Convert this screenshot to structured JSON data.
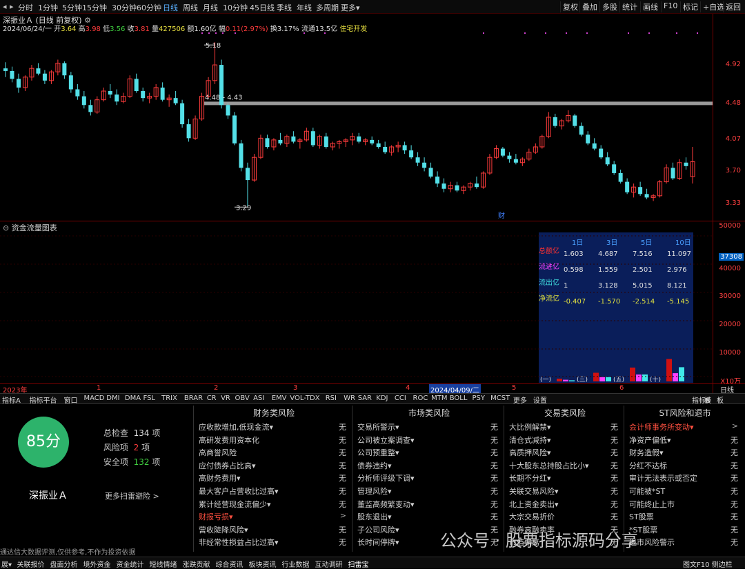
{
  "toolbar": {
    "periods": [
      "分时",
      "1分钟",
      "5分钟",
      "15分钟",
      "30分钟",
      "60分钟",
      "日线",
      "周线",
      "月线",
      "10分钟",
      "45日线",
      "季线",
      "年线",
      "多周期",
      "更多▾"
    ],
    "active": "日线",
    "right": [
      "复权",
      "叠加",
      "多股",
      "统计",
      "画线",
      "F10",
      "标记",
      "+自选",
      "返回"
    ]
  },
  "stock": {
    "name": "深振业Ａ",
    "mode": "(日线 前复权)"
  },
  "quote": {
    "date": "2024/06/24/一",
    "open_l": "开",
    "open": "3.64",
    "high_l": "高",
    "high": "3.98",
    "low_l": "低",
    "low": "3.56",
    "close_l": "收",
    "close": "3.81",
    "vol_l": "量",
    "vol": "427506",
    "amt_l": "额",
    "amt": "1.60亿",
    "chg_l": "幅",
    "chg": "0.11(2.97%)",
    "turn_l": "换",
    "turn": "3.17%",
    "float_l": "流通",
    "float": "13.5亿",
    "industry": "住宅开发"
  },
  "price_axis": [
    "4.92",
    "4.48",
    "4.07",
    "3.70",
    "3.33"
  ],
  "annotations": {
    "high": "5.18",
    "range": "4.48 - 4.43",
    "low": "3.29",
    "cai": "财"
  },
  "flow": {
    "title": "资金流量图表",
    "axis": [
      "50000",
      "40000",
      "37308",
      "30000",
      "20000",
      "10000",
      "X10万"
    ],
    "headers": [
      "1日",
      "3日",
      "5日",
      "10日"
    ],
    "rows": [
      {
        "label": "总额亿",
        "vals": [
          "1.603",
          "4.687",
          "7.516",
          "11.097"
        ]
      },
      {
        "label": "流进亿",
        "vals": [
          "0.598",
          "1.559",
          "2.501",
          "2.976"
        ]
      },
      {
        "label": "流出亿",
        "vals": [
          "1",
          "3.128",
          "5.015",
          "8.121"
        ]
      },
      {
        "label": "净流亿",
        "vals": [
          "-0.407",
          "-1.570",
          "-2.514",
          "-5.145"
        ]
      }
    ],
    "groups": [
      "(一)",
      "(三)",
      "(五)",
      "(十)"
    ],
    "bars": [
      {
        "in": 0.598,
        "out": 1
      },
      {
        "in": 1.559,
        "out": 3.128
      },
      {
        "in": 2.501,
        "out": 5.015
      },
      {
        "in": 2.976,
        "out": 8.121
      }
    ]
  },
  "timeline": [
    "2023年",
    "1",
    "2",
    "3",
    "4",
    "2024/04/09/二",
    "5",
    "6",
    "日线"
  ],
  "indicators": [
    "指标A",
    "指标平台",
    "窗口",
    "MACD",
    "DMI",
    "DMA",
    "FSL",
    "TRIX",
    "BRAR",
    "CR",
    "VR",
    "OBV",
    "ASI",
    "EMV",
    "VOL-TDX",
    "RSI",
    "WR",
    "SAR",
    "KDJ",
    "CCI",
    "ROC",
    "MTM",
    "BOLL",
    "PSY",
    "MCST",
    "更多",
    "设置"
  ],
  "ind_right": [
    "指标B",
    "模",
    "板"
  ],
  "scan": {
    "score": "85分",
    "stock": "深振业Ａ",
    "total_l": "总检查",
    "total": "134",
    "total_u": "项",
    "risk_l": "风险项",
    "risk": "2",
    "risk_u": "项",
    "safe_l": "安全项",
    "safe": "132",
    "safe_u": "项",
    "more": "更多扫雷避险 >"
  },
  "columns": [
    {
      "title": "财务类风险",
      "items": [
        [
          "应收款增加,低现金流▾",
          "无"
        ],
        [
          "高研发费用资本化",
          "无"
        ],
        [
          "高商誉风险",
          "无"
        ],
        [
          "应付债券占比高▾",
          "无"
        ],
        [
          "高财务费用▾",
          "无"
        ],
        [
          "最大客户占营收比过高▾",
          "无"
        ],
        [
          "累计经营现金流偏少▾",
          "无"
        ],
        [
          "财报亏损▾",
          ">"
        ],
        [
          "营收陡降风险▾",
          "无"
        ],
        [
          "非经常性损益占比过高▾",
          "无"
        ]
      ]
    },
    {
      "title": "市场类风险",
      "items": [
        [
          "交易所警示▾",
          "无"
        ],
        [
          "公司被立案调查▾",
          "无"
        ],
        [
          "公司预重整▾",
          "无"
        ],
        [
          "债券违约▾",
          "无"
        ],
        [
          "分析师评级下调▾",
          "无"
        ],
        [
          "管理风险▾",
          "无"
        ],
        [
          "董监高频繁变动▾",
          "无"
        ],
        [
          "股东退出▾",
          "无"
        ],
        [
          "子公司风险▾",
          "无"
        ],
        [
          "长时间停牌▾",
          "无"
        ]
      ]
    },
    {
      "title": "交易类风险",
      "items": [
        [
          "大比例解禁▾",
          "无"
        ],
        [
          "清仓式减持▾",
          "无"
        ],
        [
          "高质押风险▾",
          "无"
        ],
        [
          "十大股东总持股占比小▾",
          "无"
        ],
        [
          "长期不分红▾",
          "无"
        ],
        [
          "关联交易风险▾",
          "无"
        ],
        [
          "北上资金卖出▾",
          "无"
        ],
        [
          "大宗交易折价",
          "无"
        ],
        [
          "融券高融卖率",
          "无"
        ],
        [
          "市值偏离",
          "无"
        ]
      ]
    },
    {
      "title": "ST风险和退市",
      "items": [
        [
          "会计师事务所变动▾",
          ">"
        ],
        [
          "净资产偏低▾",
          "无"
        ],
        [
          "财务造假▾",
          "无"
        ],
        [
          "分红不达标",
          "无"
        ],
        [
          "审计无法表示或否定",
          "无"
        ],
        [
          "可能被*ST",
          "无"
        ],
        [
          "可能终止上市",
          "无"
        ],
        [
          "ST股票",
          "无"
        ],
        [
          "*ST股票",
          "无"
        ],
        [
          "退市风险警示",
          "无"
        ]
      ]
    }
  ],
  "disclaimer": "通达信大数据评测,仅供参考,不作为投资依据",
  "status": [
    "展▾",
    "关联报价",
    "盘面分析",
    "境外资金",
    "资金统计",
    "短线情绪",
    "涨跌贡献",
    "综合资讯",
    "板块资讯",
    "行业数据",
    "互动调研",
    "扫雷宝"
  ],
  "status_right": "图文F10 侧边栏",
  "watermark": "公众号 · 股票指标源码分享",
  "chart_data": {
    "type": "candlestick",
    "ylim": [
      3.15,
      5.3
    ],
    "ohlc": [
      [
        4.88,
        4.95,
        4.78,
        4.85
      ],
      [
        4.85,
        4.9,
        4.72,
        4.76
      ],
      [
        4.76,
        4.82,
        4.6,
        4.66
      ],
      [
        4.66,
        4.8,
        4.62,
        4.78
      ],
      [
        4.78,
        4.92,
        4.74,
        4.88
      ],
      [
        4.88,
        4.94,
        4.8,
        4.82
      ],
      [
        4.82,
        4.86,
        4.7,
        4.74
      ],
      [
        4.74,
        4.86,
        4.7,
        4.84
      ],
      [
        4.84,
        4.98,
        4.8,
        4.94
      ],
      [
        4.94,
        4.96,
        4.76,
        4.8
      ],
      [
        4.8,
        4.84,
        4.6,
        4.64
      ],
      [
        4.64,
        4.7,
        4.52,
        4.56
      ],
      [
        4.56,
        4.62,
        4.42,
        4.46
      ],
      [
        4.46,
        4.52,
        4.34,
        4.38
      ],
      [
        4.38,
        4.56,
        4.36,
        4.52
      ],
      [
        4.52,
        4.66,
        4.5,
        4.62
      ],
      [
        4.62,
        4.7,
        4.54,
        4.58
      ],
      [
        4.58,
        4.64,
        4.46,
        4.5
      ],
      [
        4.5,
        4.6,
        4.48,
        4.56
      ],
      [
        4.56,
        4.8,
        4.54,
        4.76
      ],
      [
        4.76,
        4.82,
        4.6,
        4.62
      ],
      [
        4.62,
        4.66,
        4.5,
        4.54
      ],
      [
        4.54,
        4.6,
        4.48,
        4.56
      ],
      [
        4.56,
        4.7,
        4.52,
        4.66
      ],
      [
        4.66,
        4.72,
        4.5,
        4.52
      ],
      [
        4.52,
        4.58,
        4.44,
        4.54
      ],
      [
        4.54,
        4.62,
        4.46,
        4.48
      ],
      [
        4.48,
        4.52,
        4.2,
        4.24
      ],
      [
        4.24,
        4.3,
        4.04,
        4.08
      ],
      [
        4.08,
        4.34,
        4.06,
        4.3
      ],
      [
        4.3,
        4.6,
        4.28,
        4.56
      ],
      [
        4.56,
        4.78,
        4.54,
        4.74
      ],
      [
        4.74,
        5.18,
        4.7,
        4.92
      ],
      [
        4.92,
        4.98,
        4.42,
        4.46
      ],
      [
        4.46,
        4.48,
        4.3,
        4.34
      ],
      [
        4.34,
        4.38,
        4.0,
        4.02
      ],
      [
        4.02,
        4.06,
        3.7,
        3.74
      ],
      [
        3.74,
        3.8,
        3.29,
        3.6
      ],
      [
        3.6,
        3.9,
        3.58,
        3.86
      ],
      [
        3.86,
        4.12,
        3.84,
        4.08
      ],
      [
        4.08,
        4.12,
        3.96,
        3.98
      ],
      [
        3.98,
        4.08,
        3.94,
        4.06
      ],
      [
        4.06,
        4.14,
        4.0,
        4.02
      ],
      [
        4.02,
        4.12,
        3.98,
        4.1
      ],
      [
        4.1,
        4.16,
        4.02,
        4.04
      ],
      [
        4.04,
        4.08,
        3.96,
        4.06
      ],
      [
        4.06,
        4.2,
        4.04,
        4.16
      ],
      [
        4.16,
        4.2,
        3.98,
        4.0
      ],
      [
        4.0,
        4.12,
        3.96,
        4.1
      ],
      [
        4.1,
        4.14,
        3.96,
        3.98
      ],
      [
        3.98,
        4.04,
        3.94,
        4.02
      ],
      [
        4.02,
        4.06,
        3.96,
        4.04
      ],
      [
        4.04,
        4.08,
        3.98,
        4.06
      ],
      [
        4.06,
        4.14,
        4.0,
        4.1
      ],
      [
        4.1,
        4.14,
        4.02,
        4.04
      ],
      [
        4.04,
        4.08,
        4.0,
        4.06
      ],
      [
        4.06,
        4.1,
        4.0,
        4.02
      ],
      [
        4.02,
        4.06,
        3.96,
        3.98
      ],
      [
        3.98,
        4.04,
        3.9,
        3.92
      ],
      [
        3.92,
        4.0,
        3.88,
        3.98
      ],
      [
        3.98,
        4.04,
        3.92,
        4.0
      ],
      [
        4.0,
        4.04,
        3.9,
        3.94
      ],
      [
        3.94,
        4.0,
        3.84,
        3.86
      ],
      [
        3.86,
        3.92,
        3.76,
        3.8
      ],
      [
        3.8,
        3.86,
        3.7,
        3.74
      ],
      [
        3.74,
        3.8,
        3.62,
        3.64
      ],
      [
        3.64,
        3.7,
        3.52,
        3.56
      ],
      [
        3.56,
        3.62,
        3.46,
        3.5
      ],
      [
        3.5,
        3.58,
        3.46,
        3.54
      ],
      [
        3.54,
        3.58,
        3.46,
        3.48
      ],
      [
        3.48,
        3.54,
        3.44,
        3.52
      ],
      [
        3.52,
        3.58,
        3.48,
        3.56
      ],
      [
        3.56,
        3.64,
        3.5,
        3.52
      ],
      [
        3.52,
        3.7,
        3.5,
        3.68
      ],
      [
        3.68,
        3.9,
        3.66,
        3.86
      ],
      [
        3.86,
        4.0,
        3.84,
        3.96
      ],
      [
        3.96,
        3.98,
        3.86,
        3.88
      ],
      [
        3.88,
        3.92,
        3.8,
        3.84
      ],
      [
        3.84,
        3.9,
        3.78,
        3.8
      ],
      [
        3.8,
        3.86,
        3.76,
        3.84
      ],
      [
        3.84,
        3.96,
        3.82,
        3.92
      ],
      [
        3.92,
        4.02,
        3.9,
        3.98
      ],
      [
        3.98,
        4.12,
        3.96,
        4.1
      ],
      [
        4.1,
        4.38,
        4.08,
        4.32
      ],
      [
        4.32,
        4.36,
        4.2,
        4.22
      ],
      [
        4.22,
        4.3,
        4.18,
        4.28
      ],
      [
        4.28,
        4.4,
        4.26,
        4.34
      ],
      [
        4.34,
        4.36,
        4.2,
        4.22
      ],
      [
        4.22,
        4.26,
        4.1,
        4.12
      ],
      [
        4.12,
        4.16,
        4.0,
        4.02
      ],
      [
        4.02,
        4.08,
        3.94,
        3.96
      ],
      [
        3.96,
        4.0,
        3.84,
        3.86
      ],
      [
        3.86,
        3.92,
        3.76,
        3.78
      ],
      [
        3.78,
        3.82,
        3.66,
        3.68
      ],
      [
        3.68,
        3.72,
        3.56,
        3.58
      ],
      [
        3.58,
        3.62,
        3.44,
        3.46
      ],
      [
        3.46,
        3.56,
        3.4,
        3.52
      ],
      [
        3.52,
        3.58,
        3.42,
        3.44
      ],
      [
        3.44,
        3.5,
        3.38,
        3.4
      ],
      [
        3.4,
        3.44,
        3.36,
        3.42
      ],
      [
        3.42,
        3.6,
        3.4,
        3.58
      ],
      [
        3.58,
        3.78,
        3.56,
        3.74
      ],
      [
        3.74,
        3.8,
        3.6,
        3.62
      ],
      [
        3.62,
        3.84,
        3.6,
        3.8
      ],
      [
        3.8,
        3.86,
        3.72,
        3.76
      ],
      [
        3.64,
        3.98,
        3.56,
        3.81
      ]
    ]
  }
}
